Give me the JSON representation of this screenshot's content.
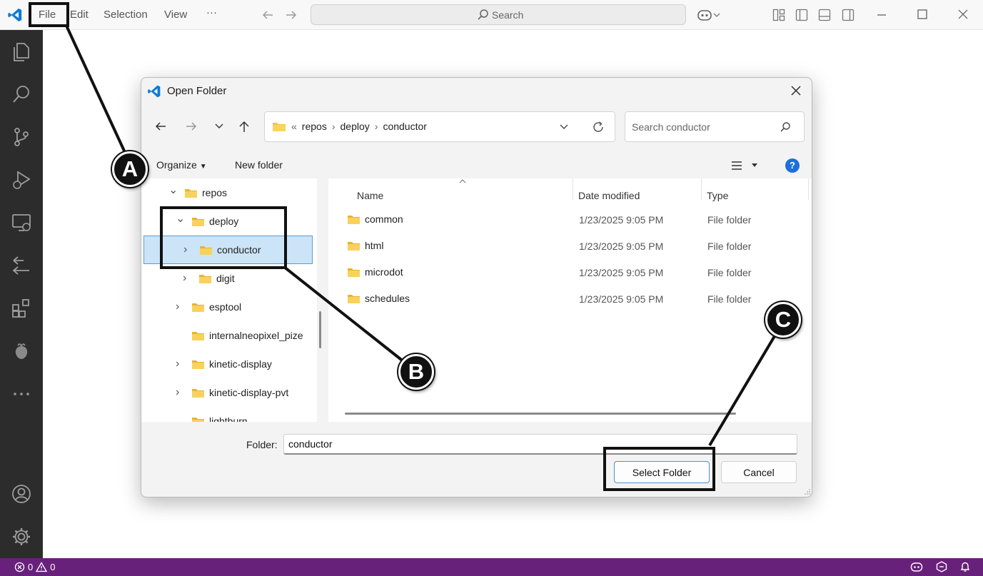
{
  "titlebar": {
    "menus": [
      "File",
      "Edit",
      "Selection",
      "View",
      "···"
    ],
    "search_label": "Search"
  },
  "statusbar": {
    "errors": "0",
    "warnings": "0"
  },
  "dialog": {
    "title": "Open Folder",
    "breadcrumb": [
      "repos",
      "deploy",
      "conductor"
    ],
    "breadcrumb_prefix": "«",
    "search_placeholder": "Search conductor",
    "organize_label": "Organize",
    "new_folder_label": "New folder",
    "help_label": "?",
    "tree": [
      {
        "label": "repos",
        "toggle": "expanded"
      },
      {
        "label": "deploy",
        "toggle": "expanded"
      },
      {
        "label": "conductor",
        "toggle": "collapsed",
        "selected": true
      },
      {
        "label": "digit",
        "toggle": "collapsed"
      },
      {
        "label": "esptool",
        "toggle": "collapsed"
      },
      {
        "label": "internalneopixel_pize",
        "toggle": "none"
      },
      {
        "label": "kinetic-display",
        "toggle": "collapsed"
      },
      {
        "label": "kinetic-display-pvt",
        "toggle": "collapsed"
      },
      {
        "label": "lightburn",
        "toggle": "none"
      }
    ],
    "columns": {
      "name": "Name",
      "date": "Date modified",
      "type": "Type"
    },
    "files": [
      {
        "name": "common",
        "date": "1/23/2025 9:05 PM",
        "type": "File folder"
      },
      {
        "name": "html",
        "date": "1/23/2025 9:05 PM",
        "type": "File folder"
      },
      {
        "name": "microdot",
        "date": "1/23/2025 9:05 PM",
        "type": "File folder"
      },
      {
        "name": "schedules",
        "date": "1/23/2025 9:05 PM",
        "type": "File folder"
      }
    ],
    "folder_label": "Folder:",
    "folder_value": "conductor",
    "select_button": "Select Folder",
    "cancel_button": "Cancel"
  },
  "annotations": {
    "a": "A",
    "b": "B",
    "c": "C"
  },
  "colors": {
    "activity_bar": "#2c2c2c",
    "status_bar": "#68217a",
    "folder": "#f4c542",
    "selection": "#cce4f7",
    "accent_blue": "#0078d4"
  }
}
